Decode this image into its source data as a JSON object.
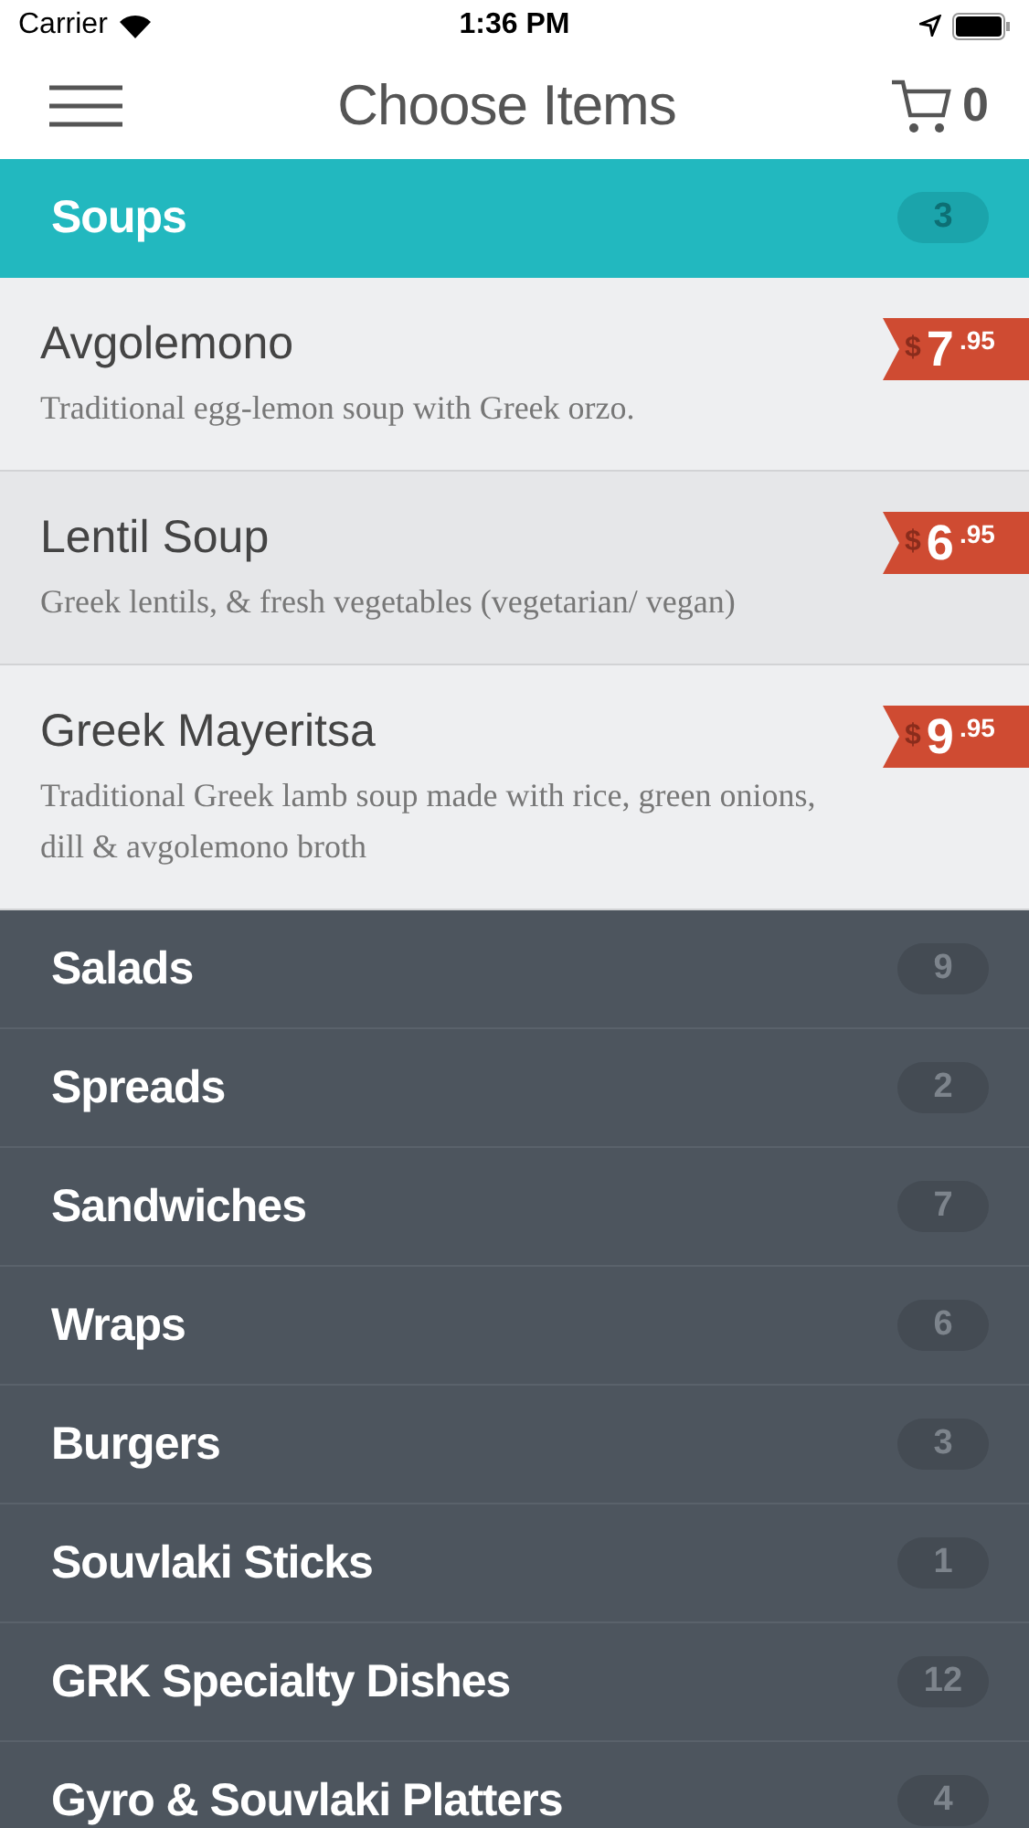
{
  "status_bar": {
    "carrier": "Carrier",
    "time": "1:36 PM"
  },
  "header": {
    "title": "Choose Items",
    "cart_count": "0"
  },
  "categories": [
    {
      "name": "Soups",
      "count": "3",
      "expanded": true,
      "items": [
        {
          "selected": false,
          "name": "Avgolemono",
          "description": "Traditional egg-lemon soup with Greek orzo.",
          "price": {
            "currency": "$",
            "whole": "7",
            "cents": ".95"
          }
        },
        {
          "selected": true,
          "name": "Lentil Soup",
          "description": "Greek lentils, & fresh vegetables (vegetarian/ vegan)",
          "price": {
            "currency": "$",
            "whole": "6",
            "cents": ".95"
          }
        },
        {
          "selected": false,
          "name": "Greek Mayeritsa",
          "description": "Traditional Greek lamb soup made with rice, green onions, dill & avgolemono broth",
          "price": {
            "currency": "$",
            "whole": "9",
            "cents": ".95"
          }
        }
      ]
    },
    {
      "name": "Salads",
      "count": "9",
      "expanded": false
    },
    {
      "name": "Spreads",
      "count": "2",
      "expanded": false
    },
    {
      "name": "Sandwiches",
      "count": "7",
      "expanded": false
    },
    {
      "name": "Wraps",
      "count": "6",
      "expanded": false
    },
    {
      "name": "Burgers",
      "count": "3",
      "expanded": false
    },
    {
      "name": "Souvlaki Sticks",
      "count": "1",
      "expanded": false
    },
    {
      "name": "GRK Specialty Dishes",
      "count": "12",
      "expanded": false
    },
    {
      "name": "Gyro & Souvlaki Platters",
      "count": "4",
      "expanded": false
    }
  ]
}
